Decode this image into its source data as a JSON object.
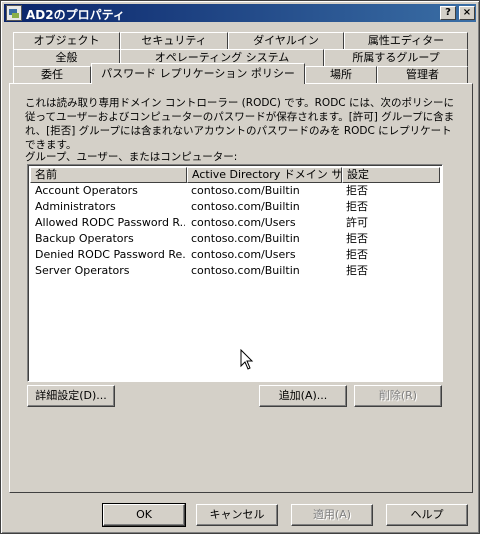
{
  "window": {
    "title": "AD2のプロパティ",
    "help_btn": "?",
    "close_btn": "×"
  },
  "tabs": {
    "row1": [
      "オブジェクト",
      "セキュリティ",
      "ダイヤルイン",
      "属性エディター"
    ],
    "row2": [
      "全般",
      "オペレーティング システム",
      "所属するグループ"
    ],
    "row3": [
      "委任",
      "パスワード レプリケーション ポリシー",
      "場所",
      "管理者"
    ],
    "active": "パスワード レプリケーション ポリシー"
  },
  "description": "これは読み取り専用ドメイン コントローラー (RODC) です。RODC には、次のポリシーに従ってユーザーおよびコンピューターのパスワードが保存されます。[許可] グループに含まれ、[拒否] グループには含まれないアカウントのパスワードのみを RODC にレプリケートできます。",
  "list_label": "グループ、ユーザー、またはコンピューター:",
  "columns": [
    "名前",
    "Active Directory ドメイン サ...",
    "設定"
  ],
  "rows": [
    {
      "name": "Account Operators",
      "domain": "contoso.com/Builtin",
      "setting": "拒否"
    },
    {
      "name": "Administrators",
      "domain": "contoso.com/Builtin",
      "setting": "拒否"
    },
    {
      "name": "Allowed RODC Password R...",
      "domain": "contoso.com/Users",
      "setting": "許可"
    },
    {
      "name": "Backup Operators",
      "domain": "contoso.com/Builtin",
      "setting": "拒否"
    },
    {
      "name": "Denied RODC Password Re...",
      "domain": "contoso.com/Users",
      "setting": "拒否"
    },
    {
      "name": "Server Operators",
      "domain": "contoso.com/Builtin",
      "setting": "拒否"
    }
  ],
  "buttons": {
    "advanced": "詳細設定(D)...",
    "add": "追加(A)...",
    "remove": "削除(R)",
    "ok": "OK",
    "cancel": "キャンセル",
    "apply": "適用(A)",
    "help": "ヘルプ"
  }
}
